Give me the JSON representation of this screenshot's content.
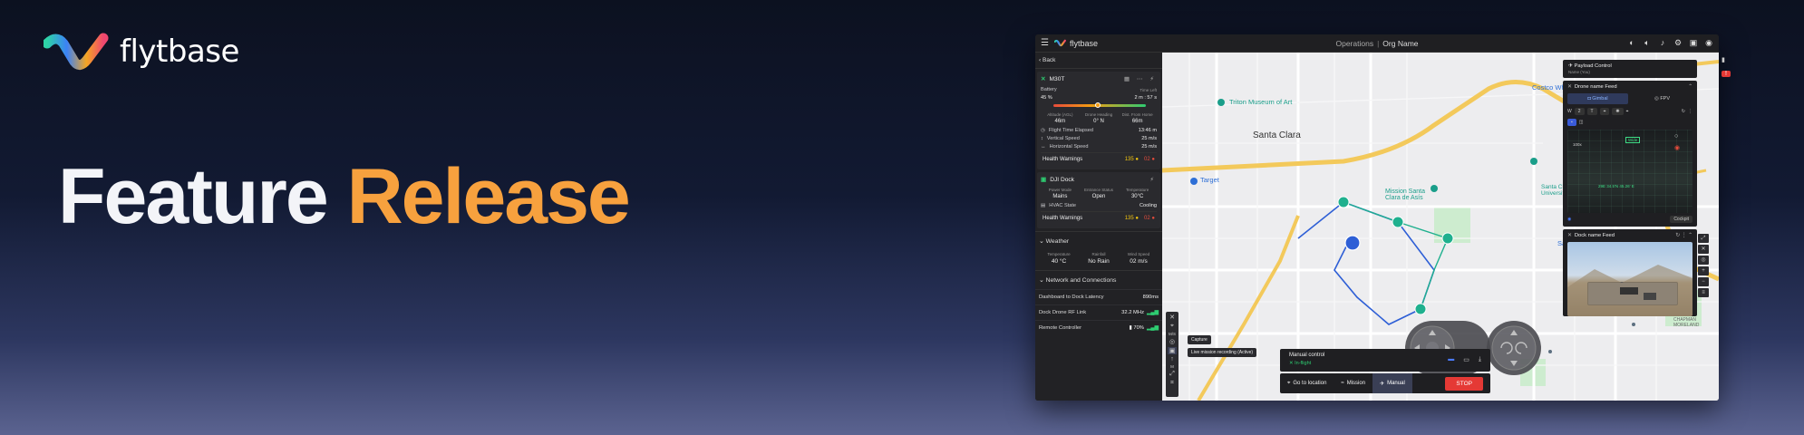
{
  "hero": {
    "brand": "flytbase",
    "title_word1": "Feature",
    "title_word2": "Release"
  },
  "colors": {
    "accent": "#f7a13e",
    "stop": "#e53935",
    "ok": "#2ecc71",
    "route": "#2e5fd6",
    "waypoint": "#1fb08e"
  },
  "topbar": {
    "brand": "flytbase",
    "section": "Operations",
    "org": "Org Name",
    "icons": [
      "menu-icon",
      "volume-icon",
      "bell-icon",
      "settings-icon",
      "gift-icon",
      "user-icon"
    ]
  },
  "left_panel": {
    "back": "Back",
    "drone": {
      "name": "M30T",
      "battery_label": "Battery",
      "battery_pct": "45 %",
      "battery_level": 0.45,
      "time_left_label": "Time Left",
      "time_left": "2 m : 57 s",
      "altitude_label": "Altitude (AGL)",
      "altitude": "46m",
      "heading_label": "Drone Heading",
      "heading": "0° N",
      "dist_label": "Dist. From Home",
      "dist": "66m",
      "flight_time_label": "Flight Time Elapsed",
      "flight_time": "13:46 m",
      "vspeed_label": "Vertical Speed",
      "vspeed": "25 m/s",
      "hspeed_label": "Horizontal Speed",
      "hspeed": "25 m/s",
      "warnings_label": "Health Warnings",
      "warn_yellow": "135",
      "warn_red": "02"
    },
    "dock": {
      "name": "DJI Dock",
      "power_label": "Power Mode",
      "power": "Mains",
      "entrance_label": "Entrance Status",
      "entrance": "Open",
      "temp_label": "Temperature",
      "temp": "30°C",
      "hvac_label": "HVAC State",
      "hvac": "Cooling",
      "warnings_label": "Health Warnings",
      "warn_yellow": "135",
      "warn_red": "02"
    },
    "weather": {
      "title": "Weather",
      "temp_label": "Temperature",
      "temp": "40 °C",
      "rain_label": "Rainfall",
      "rain": "No Rain",
      "wind_label": "Wind Speed",
      "wind": "02 m/s"
    },
    "network": {
      "title": "Network and Connections",
      "latency_label": "Dashboard to Dock Latency",
      "latency": "890ms",
      "rf_label": "Dock Drone RF Link",
      "rf": "32.2 MHz",
      "rc_label": "Remote Controller",
      "rc": "70%"
    }
  },
  "map": {
    "labels": {
      "costco": "Costco Wholesale",
      "triton": "Triton Museum of Art",
      "santa_clara": "Santa Clara",
      "mission": "Mission Santa Clara de Asís",
      "university": "Santa Clara University",
      "target": "Target",
      "safeway": "Safeway",
      "chapman": "CHAPMAN MORELAND"
    },
    "tooltips": {
      "capture": "Capture",
      "recording": "Live mission recording (Active)"
    },
    "tool_labels": {
      "ms": "M/S",
      "m": "M"
    }
  },
  "manual": {
    "title": "Manual control",
    "status": "In-flight",
    "bottom": {
      "goto": "Go to location",
      "mission": "Mission",
      "manual": "Manual",
      "stop": "STOP"
    }
  },
  "right": {
    "payload_title": "Payload Control",
    "payload_sub": "Name (You)",
    "drone_feed": "Drone name Feed",
    "tab_gimbal": "Gimbal",
    "tab_fpv": "FPV",
    "zoom_w": "W",
    "zoom_2": "2",
    "zoom_t": "T",
    "cam_hud": "Wide",
    "cam_coords": "29E 34.5'N 45.26' E",
    "zoom_level": "100x",
    "cockpit": "Cockpit",
    "dock_feed": "Dock name Feed"
  }
}
